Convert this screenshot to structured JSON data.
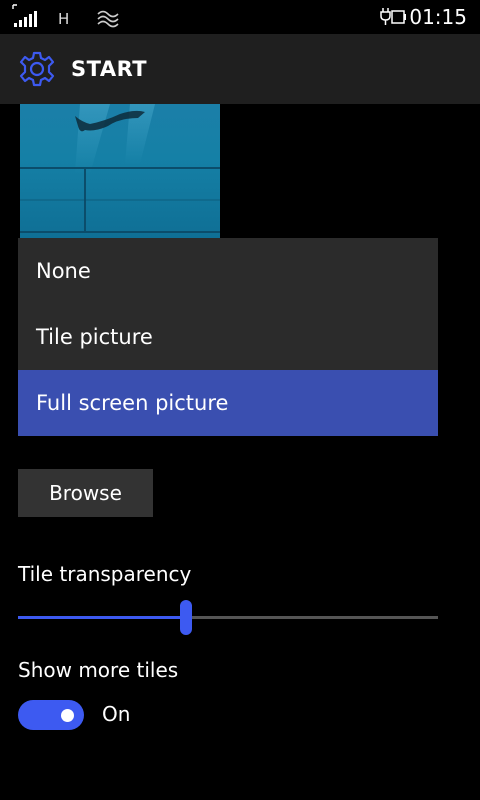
{
  "status_bar": {
    "network_type": "H",
    "time": "01:15",
    "icons": [
      "signal-strength-icon",
      "wifi-icon",
      "battery-charging-icon"
    ]
  },
  "header": {
    "title": "START",
    "icon": "gear-icon",
    "accent_color": "#3d5af1"
  },
  "background_dropdown": {
    "options": [
      {
        "label": "None",
        "selected": false
      },
      {
        "label": "Tile picture",
        "selected": false
      },
      {
        "label": "Full screen picture",
        "selected": true
      }
    ],
    "selected_color": "#3a4fb0"
  },
  "browse_button": {
    "label": "Browse"
  },
  "tile_transparency": {
    "label": "Tile transparency",
    "value_fraction": 0.4
  },
  "show_more_tiles": {
    "label": "Show more tiles",
    "state": "On",
    "enabled": true
  }
}
